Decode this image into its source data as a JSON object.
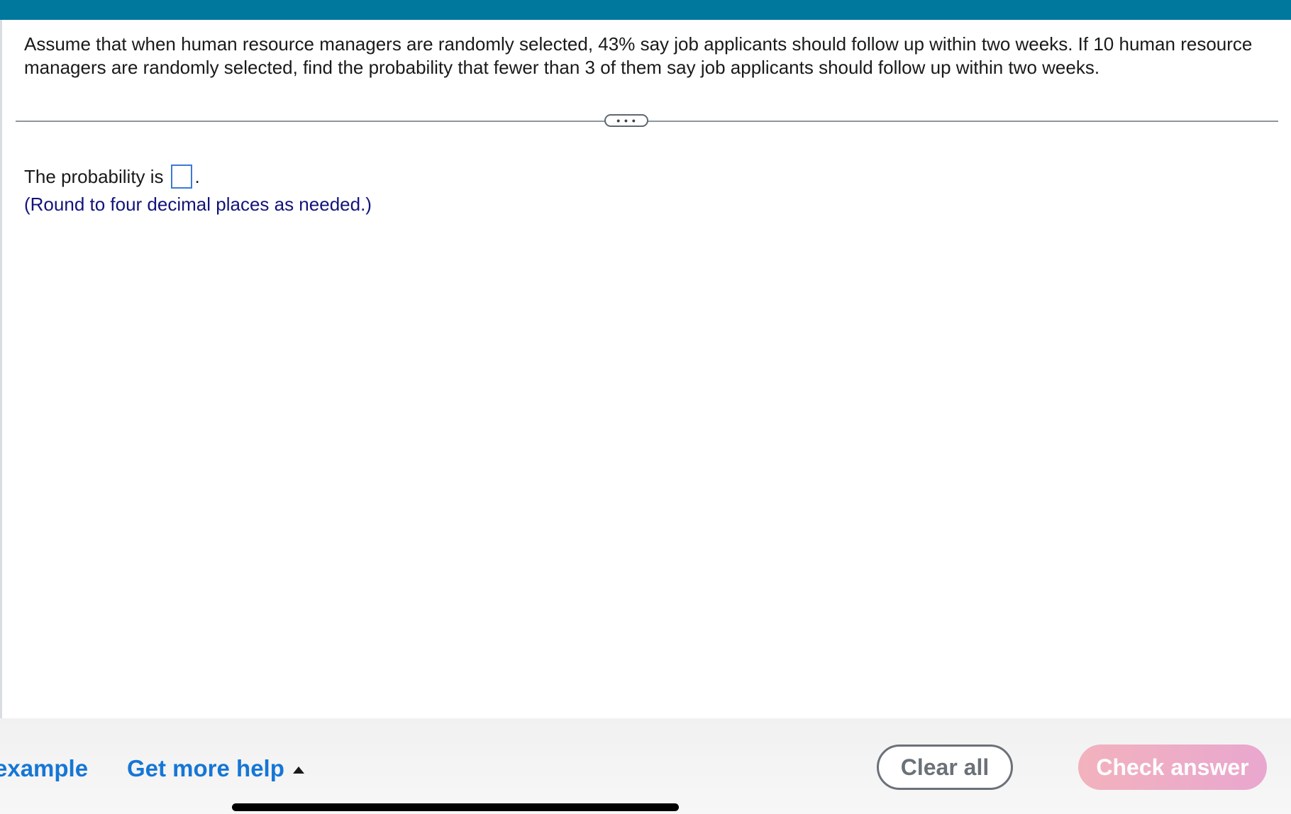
{
  "question": {
    "text": "Assume that when human resource managers are randomly selected, 43% say job applicants should follow up within two weeks. If 10 human resource managers are randomly selected, find the probability that fewer than 3 of them say job applicants should follow up within two weeks."
  },
  "divider": {
    "expand_label": "• • •"
  },
  "answer": {
    "prefix": "The probability is",
    "suffix": ".",
    "value": "",
    "hint": "(Round to four decimal places as needed.)"
  },
  "footer": {
    "example_label": "example",
    "help_label": "Get more help",
    "clear_label": "Clear all",
    "check_label": "Check answer"
  },
  "colors": {
    "header": "#00789e",
    "link": "#1576d6",
    "hint": "#13137a",
    "check_button": "#f2b2bd"
  },
  "icons": {
    "help_menu": "caret-up-icon",
    "expand": "ellipsis-icon"
  }
}
